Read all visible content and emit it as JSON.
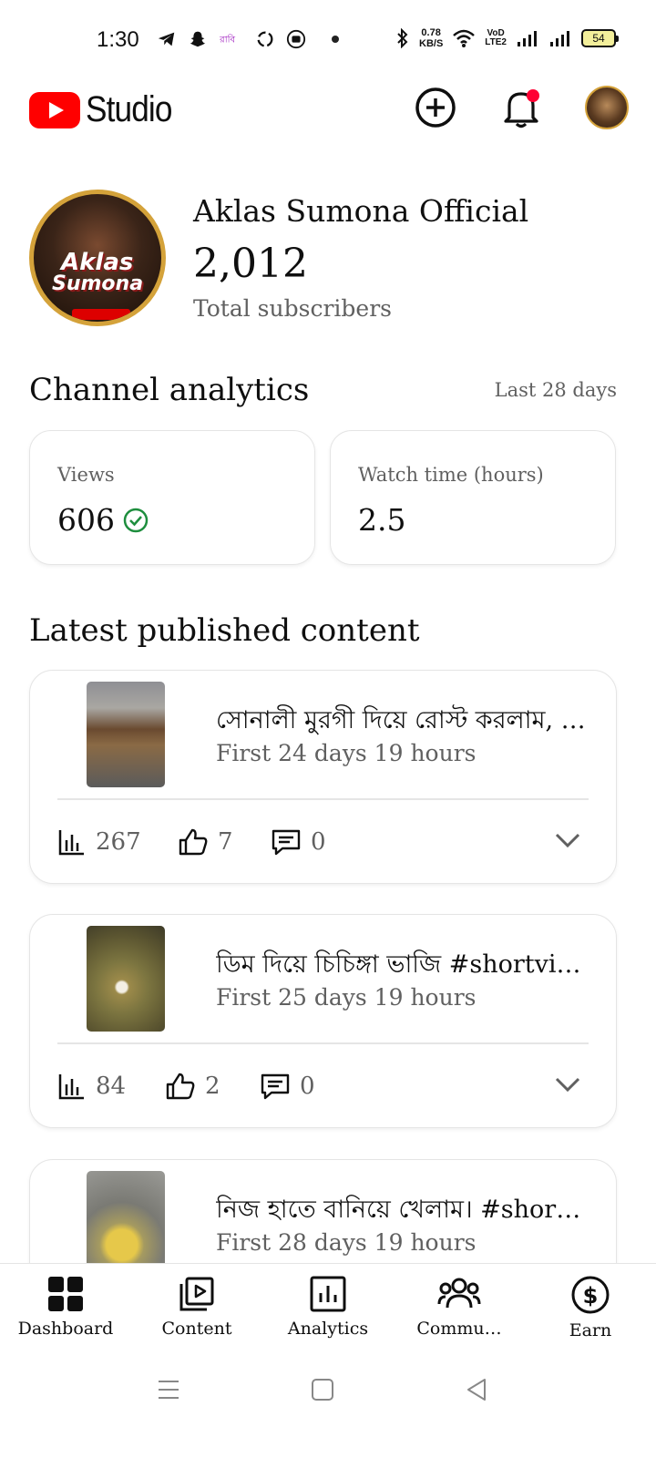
{
  "status_bar": {
    "time": "1:30",
    "net_speed_value": "0.78",
    "net_speed_unit": "KB/S",
    "volte_top": "VoD",
    "volte_bottom": "LTE2",
    "battery": "54"
  },
  "app_bar": {
    "logo_text": "Studio",
    "brand_color": "#ff0000",
    "notification_dot_color": "#ff0033"
  },
  "channel": {
    "name": "Aklas Sumona Official",
    "subscribers": "2,012",
    "subscribers_label": "Total subscribers",
    "avatar_text_line1": "Aklas",
    "avatar_text_line2": "Sumona"
  },
  "analytics": {
    "title": "Channel analytics",
    "period": "Last 28 days",
    "cards": [
      {
        "label": "Views",
        "value": "606",
        "status_icon": "check-circle-icon"
      },
      {
        "label": "Watch time (hours)",
        "value": "2.5"
      }
    ]
  },
  "latest": {
    "title": "Latest published content",
    "items": [
      {
        "title": "সোনালী মুরগী দিয়ে রোস্ট করলাম, #shortvideo",
        "meta": "First 24 days 19 hours",
        "views": "267",
        "likes": "7",
        "comments": "0"
      },
      {
        "title": "ডিম দিয়ে চিচিঙ্গা ভাজি #shortvideo",
        "meta": "First 25 days 19 hours",
        "views": "84",
        "likes": "2",
        "comments": "0"
      },
      {
        "title": "নিজ হাতে বানিয়ে খেলাম। #shortvideo",
        "meta": "First 28 days 19 hours",
        "views": "",
        "likes": "",
        "comments": ""
      }
    ]
  },
  "bottom_nav": {
    "items": [
      {
        "label": "Dashboard",
        "icon": "dashboard-icon"
      },
      {
        "label": "Content",
        "icon": "content-icon"
      },
      {
        "label": "Analytics",
        "icon": "analytics-icon"
      },
      {
        "label": "Commu…",
        "icon": "community-icon"
      },
      {
        "label": "Earn",
        "icon": "earn-icon"
      }
    ]
  }
}
